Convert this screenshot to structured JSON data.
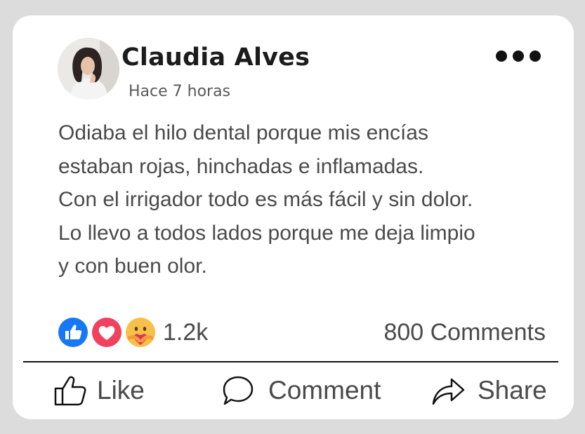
{
  "post": {
    "author": "Claudia Alves",
    "timestamp": "Hace 7 horas",
    "text_lines": [
      "Odiaba el hilo dental porque mis encías",
      "estaban rojas, hinchadas e inflamadas.",
      "Con el irrigador todo es más fácil y sin dolor.",
      "Lo llevo a todos lados porque me deja limpio",
      "y con buen olor."
    ],
    "more_icon": "more-horizontal-icon"
  },
  "reactions": {
    "icons": [
      "like-icon",
      "love-icon",
      "care-icon"
    ],
    "count": "1.2k",
    "comments": "800 Comments"
  },
  "actions": {
    "like": "Like",
    "comment": "Comment",
    "share": "Share"
  },
  "colors": {
    "like_blue": "#1877f2",
    "love_red": "#f0415e",
    "care_yellow": "#f7c04a",
    "text_gray": "#4a4a4a",
    "background": "#dcdcdc"
  }
}
